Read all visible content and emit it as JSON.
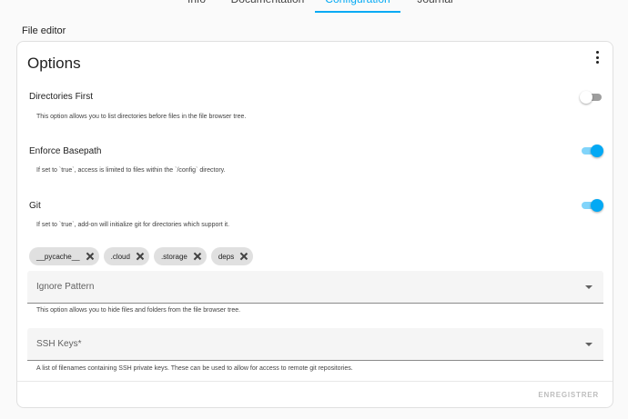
{
  "tabs": [
    {
      "label": "Info",
      "active": false
    },
    {
      "label": "Documentation",
      "active": false
    },
    {
      "label": "Configuration",
      "active": true
    },
    {
      "label": "Journal",
      "active": false
    }
  ],
  "section_title": "File editor",
  "card": {
    "title": "Options",
    "menu_icon": "kebab-menu-icon",
    "options": [
      {
        "label": "Directories First",
        "description": "This option allows you to list directories before files in the file browser tree.",
        "enabled": false
      },
      {
        "label": "Enforce Basepath",
        "description": "If set to `true`, access is limited to files within the `/config` directory.",
        "enabled": true
      },
      {
        "label": "Git",
        "description": "If set to `true`, add-on will initialize git for directories which support it.",
        "enabled": true
      }
    ],
    "chips": [
      "__pycache__",
      ".cloud",
      ".storage",
      "deps"
    ],
    "ignore_pattern": {
      "label": "Ignore Pattern",
      "help": "This option allows you to hide files and folders from the file browser tree."
    },
    "ssh_keys": {
      "label": "SSH Keys*",
      "help": "A list of filenames containing SSH private keys. These can be used to allow for access to remote git repositories."
    },
    "save_label": "ENREGISTRER"
  },
  "colors": {
    "accent": "#03a9f4",
    "accent_track": "#81d4fa",
    "chip_bg": "#e0e0e0",
    "field_bg": "#f5f5f5",
    "disabled_text": "#bdbdbd"
  }
}
